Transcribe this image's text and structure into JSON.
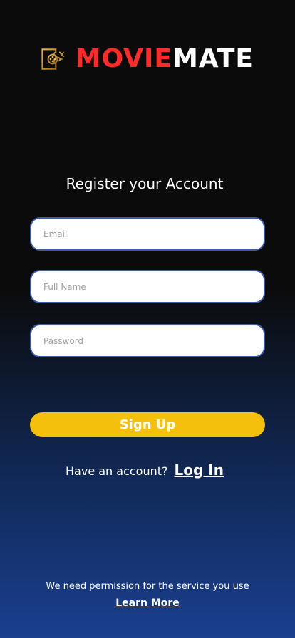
{
  "brand": {
    "name_part1": "MOVIE",
    "name_part2": "MATE",
    "color_part1": "#ff2a2a",
    "color_part2": "#ffffff",
    "icon": "ticket-film-reel-icon"
  },
  "form": {
    "heading": "Register your Account",
    "email_placeholder": "Email",
    "fullname_placeholder": "Full Name",
    "password_placeholder": "Password",
    "field_border_color": "#3d5bb0"
  },
  "signup": {
    "label": "Sign Up",
    "color": "#f5c00b"
  },
  "login_prompt": {
    "text": "Have an account?",
    "link_label": "Log In"
  },
  "footer": {
    "permission_text": "We need permission for the service you use",
    "learn_more_label": "Learn More"
  }
}
